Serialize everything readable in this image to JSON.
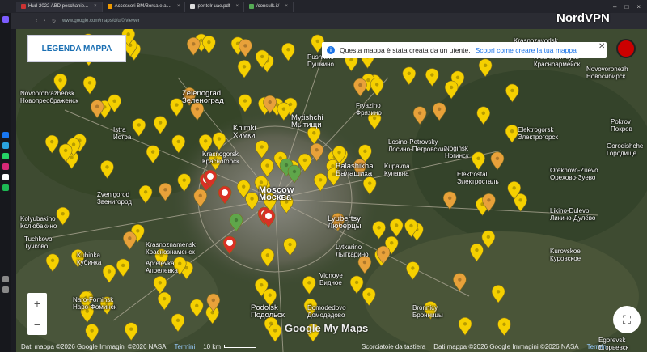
{
  "tabs": [
    {
      "label": "Hud-2022 ABD peschanie..."
    },
    {
      "label": "Accessori BM/Borsa e al..."
    },
    {
      "label": "pentolr uae.pdf"
    },
    {
      "label": "/consulk.it/"
    }
  ],
  "browser": {
    "url": "www.google.com/maps/d/u/0/viewer"
  },
  "legend_button": {
    "label": "LEGENDA MAPPA"
  },
  "info_bar": {
    "message": "Questa mappa è stata creata da un utente.",
    "link": "Scopri come creare la tua mappa"
  },
  "overlay": {
    "vpn_label": "NordVPN"
  },
  "zoom": {
    "plus": "+",
    "minus": "−"
  },
  "brand": {
    "label": "Google My Maps"
  },
  "attribution": {
    "data": "Dati mappa ©2026 Google Immagini ©2026 NASA",
    "terms": "Termini",
    "scale": "10 km",
    "shortcuts": "Scorciatoie da tastiera",
    "data2": "Dati mappa ©2026 Google Immagini ©2026 NASA",
    "terms2": "Termini"
  },
  "places": [
    {
      "text": "Zelenograd\nЗеленоград",
      "size": "med"
    },
    {
      "text": "Khimki\nХимки",
      "size": "med"
    },
    {
      "text": "Mytishchi\nМытищи",
      "size": "med"
    },
    {
      "text": "Balashikha\nБалашиха",
      "size": "med"
    },
    {
      "text": "Moscow\nМосква",
      "size": "big"
    },
    {
      "text": "Lyubertsy\nЛюберцы",
      "size": "med"
    },
    {
      "text": "Podolsk\nПодольск",
      "size": "med"
    },
    {
      "text": "Krasnogorsk\nКрасногорск",
      "size": "sm"
    },
    {
      "text": "Istra\nИстра",
      "size": "sm"
    },
    {
      "text": "Zvenigorod\nЗвенигород",
      "size": "sm"
    },
    {
      "text": "Kubinka\nКубинка",
      "size": "sm"
    },
    {
      "text": "Krasnoznamensk\nКраснознаменск",
      "size": "sm"
    },
    {
      "text": "Aprelevka\nАпрелевка",
      "size": "sm"
    },
    {
      "text": "Elektrogorsk\nЭлектрогорск",
      "size": "sm"
    },
    {
      "text": "Elektrostal\nЭлектросталь",
      "size": "sm"
    },
    {
      "text": "Noginsk\nНогинск",
      "size": "sm"
    },
    {
      "text": "Pushkino\nПушкино",
      "size": "sm"
    },
    {
      "text": "Losino-Petrovsky\nЛосино-Петровский",
      "size": "sm"
    },
    {
      "text": "Kupavna\nКупавна",
      "size": "sm"
    },
    {
      "text": "Vidnoye\nВидное",
      "size": "sm"
    },
    {
      "text": "Domodedovo\nДомодедово",
      "size": "sm"
    },
    {
      "text": "Bronnicy\nБронницы",
      "size": "sm"
    },
    {
      "text": "Kurovskoe\nКуровское",
      "size": "sm"
    },
    {
      "text": "Orekhovo-Zuevo\nОрехово-Зуево",
      "size": "sm"
    },
    {
      "text": "Likino-Dulevo\nЛикино-Дулёво",
      "size": "sm"
    },
    {
      "text": "Pokrov\nПокров",
      "size": "sm"
    },
    {
      "text": "Krasnoarmeysk\nКрасноармейск",
      "size": "sm"
    },
    {
      "text": "Novovoronezh\nНовосибирск",
      "size": "sm"
    },
    {
      "text": "Tuchkovo\nТучково",
      "size": "sm"
    },
    {
      "text": "Fryazino\nФрязино",
      "size": "sm"
    },
    {
      "text": "Lytkarino\nЛыткарино",
      "size": "sm"
    },
    {
      "text": "Naro-Fominsk\nНаро-Фоминск",
      "size": "sm"
    },
    {
      "text": "Krasnozavodsk\nКраснозаводск",
      "size": "sm"
    },
    {
      "text": "Egorevsk\nЕгорьевск",
      "size": "sm"
    },
    {
      "text": "Gorodishche\nГородище",
      "size": "sm"
    },
    {
      "text": "Kolyubakino\nКолюбакино",
      "size": "sm"
    },
    {
      "text": "Novoprobrazhensk\nНовопреображенск",
      "size": "sm"
    }
  ],
  "markers": {
    "yellow_count": 120,
    "orange_count": 22,
    "red_fire_count": 6,
    "green_count": 3
  },
  "colors": {
    "yellow": "#f5d000",
    "orange": "#e8a13a",
    "red": "#d93025",
    "green": "#5fa64a",
    "accent": "#1a73e8"
  }
}
